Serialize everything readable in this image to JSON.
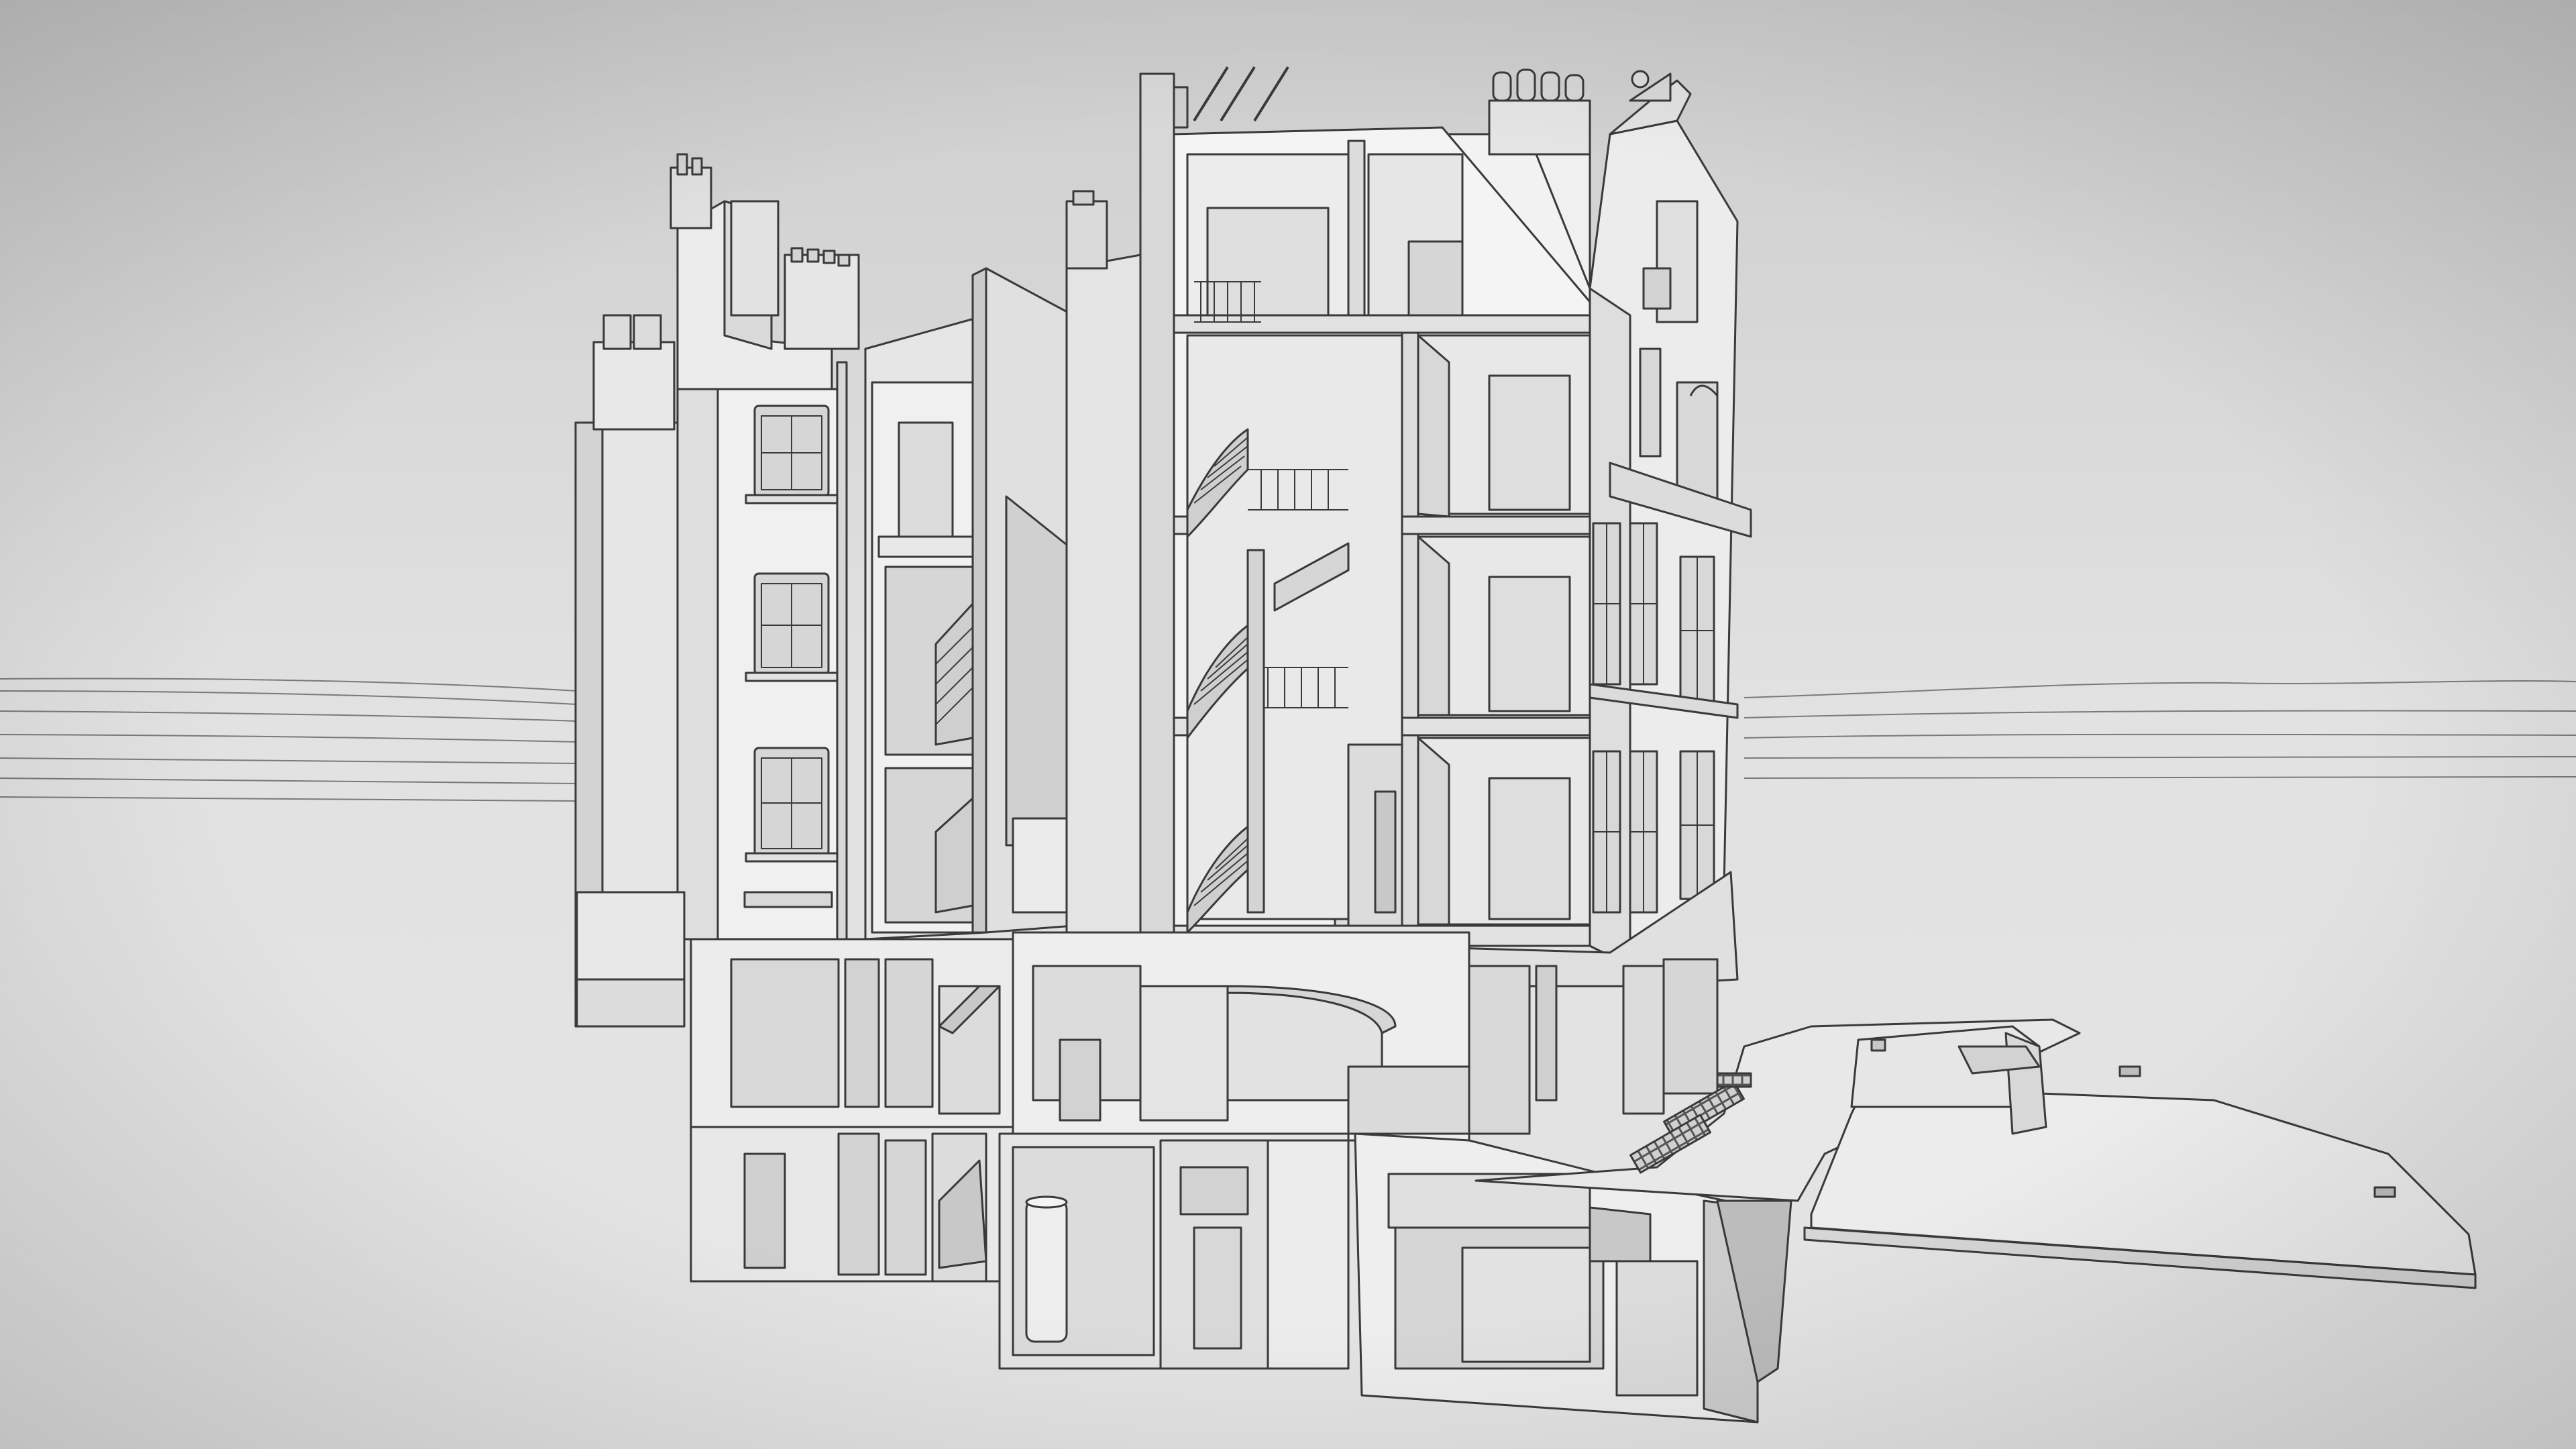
{
  "scene": {
    "subject": "building-section-cutaway",
    "palette": {
      "background_top": "#cfcfcf",
      "background_bottom": "#e6e6e6",
      "face_light": "#f4f4f4",
      "face_mid": "#e4e4e4",
      "face_dark": "#cfcfcf",
      "face_shadow": "#bdbdbd",
      "line": "#3a3a3a",
      "hill_line": "#7a7a7a"
    }
  }
}
